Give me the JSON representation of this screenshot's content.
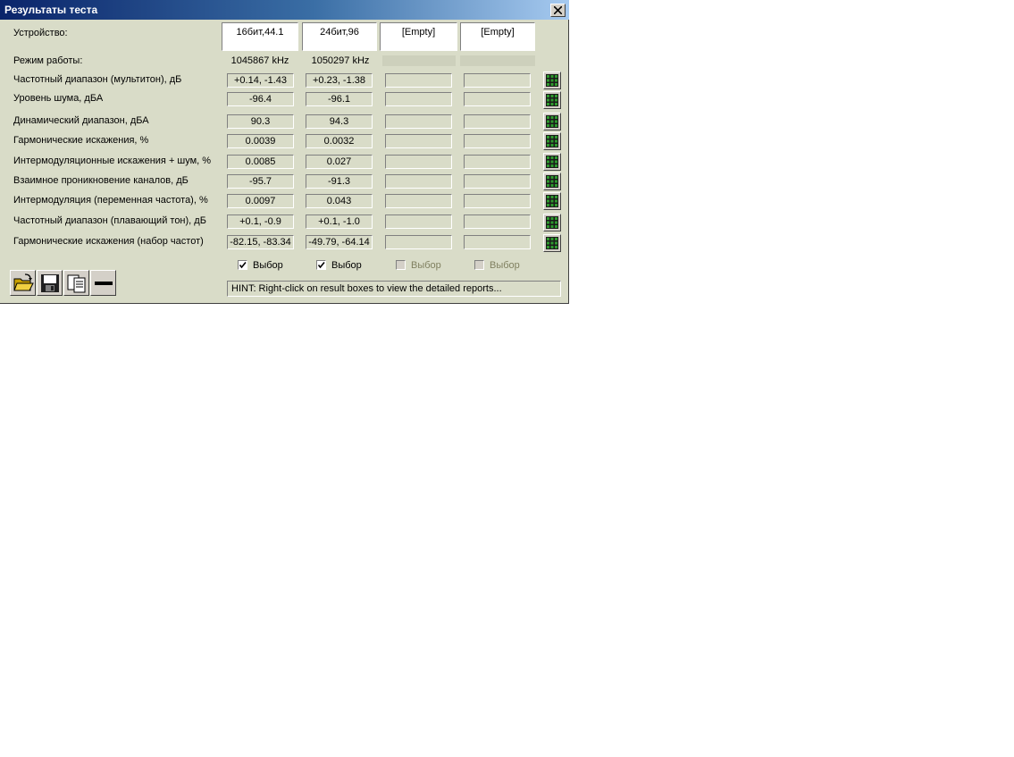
{
  "window": {
    "title": "Результаты теста"
  },
  "labels": {
    "device": "Устройство:",
    "mode": "Режим работы:"
  },
  "devices": [
    "16бит,44.1",
    "24бит,96",
    "[Empty]",
    "[Empty]"
  ],
  "modes": [
    "1045867 kHz",
    "1050297 kHz",
    "",
    ""
  ],
  "rows": [
    {
      "label": "Частотный диапазон (мультитон), дБ",
      "values": [
        "+0.14, -1.43",
        "+0.23, -1.38",
        "",
        ""
      ]
    },
    {
      "label": "Уровень шума, дБА",
      "values": [
        "-96.4",
        "-96.1",
        "",
        ""
      ]
    },
    {
      "label": "Динамический диапазон, дБА",
      "values": [
        "90.3",
        "94.3",
        "",
        ""
      ]
    },
    {
      "label": "Гармонические искажения, %",
      "values": [
        "0.0039",
        "0.0032",
        "",
        ""
      ]
    },
    {
      "label": "Интермодуляционные искажения + шум, %",
      "values": [
        "0.0085",
        "0.027",
        "",
        ""
      ]
    },
    {
      "label": "Взаимное проникновение каналов, дБ",
      "values": [
        "-95.7",
        "-91.3",
        "",
        ""
      ]
    },
    {
      "label": "Интермодуляция (переменная частота), %",
      "values": [
        "0.0097",
        "0.043",
        "",
        ""
      ]
    },
    {
      "label": "Частотный диапазон (плавающий тон), дБ",
      "values": [
        "+0.1, -0.9",
        "+0.1, -1.0",
        "",
        ""
      ]
    },
    {
      "label": "Гармонические искажения (набор частот)",
      "values": [
        "-82.15, -83.34",
        "-49.79, -64.14",
        "",
        ""
      ]
    }
  ],
  "checkboxes": [
    {
      "label": "Выбор",
      "checked": true,
      "enabled": true
    },
    {
      "label": "Выбор",
      "checked": true,
      "enabled": true
    },
    {
      "label": "Выбор",
      "checked": false,
      "enabled": false
    },
    {
      "label": "Выбор",
      "checked": false,
      "enabled": false
    }
  ],
  "hint": "HINT: Right-click on result boxes to view the detailed reports...",
  "toolbar": [
    "open-folder-icon",
    "save-disk-icon",
    "copy-icon",
    "minimize-icon"
  ],
  "colors": {
    "window_bg": "#d9dcc8",
    "title_start": "#0a246a",
    "title_end": "#a6caf0",
    "grid_icon": "#2e9a2e"
  }
}
